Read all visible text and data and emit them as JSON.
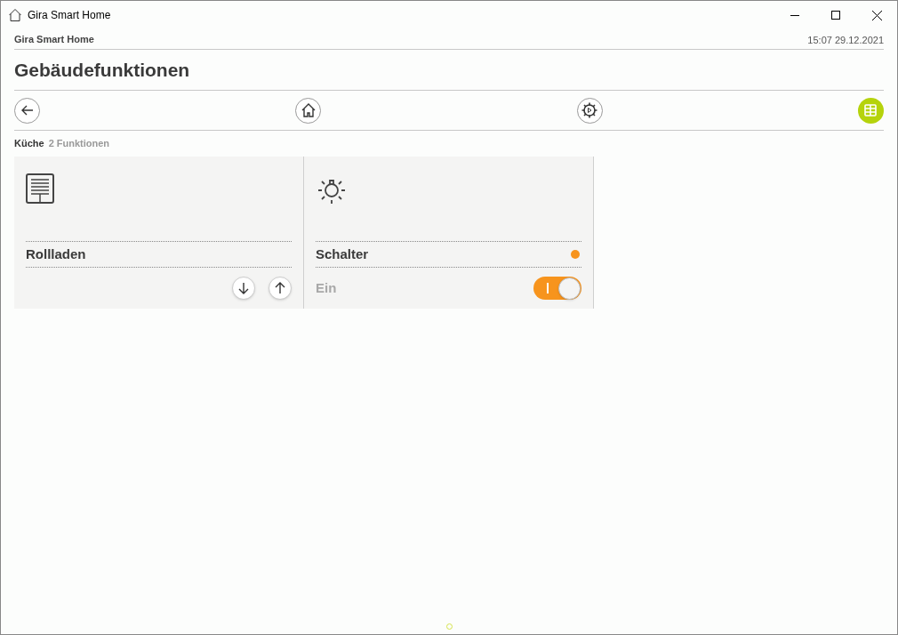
{
  "window": {
    "title": "Gira Smart Home"
  },
  "header": {
    "app_name": "Gira Smart Home",
    "datetime": "15:07 29.12.2021"
  },
  "page_title": "Gebäudefunktionen",
  "nav": [
    {
      "kind": "back",
      "selected": false
    },
    {
      "kind": "home",
      "selected": false
    },
    {
      "kind": "scenes",
      "selected": false
    },
    {
      "kind": "grid",
      "selected": true
    }
  ],
  "breadcrumb": {
    "room": "Küche",
    "count": "2 Funktionen"
  },
  "tiles": [
    {
      "kind": "shutter",
      "name": "Rollladen"
    },
    {
      "kind": "switch",
      "name": "Schalter",
      "color": "#f7941d",
      "state_label": "Ein",
      "on": true
    }
  ]
}
